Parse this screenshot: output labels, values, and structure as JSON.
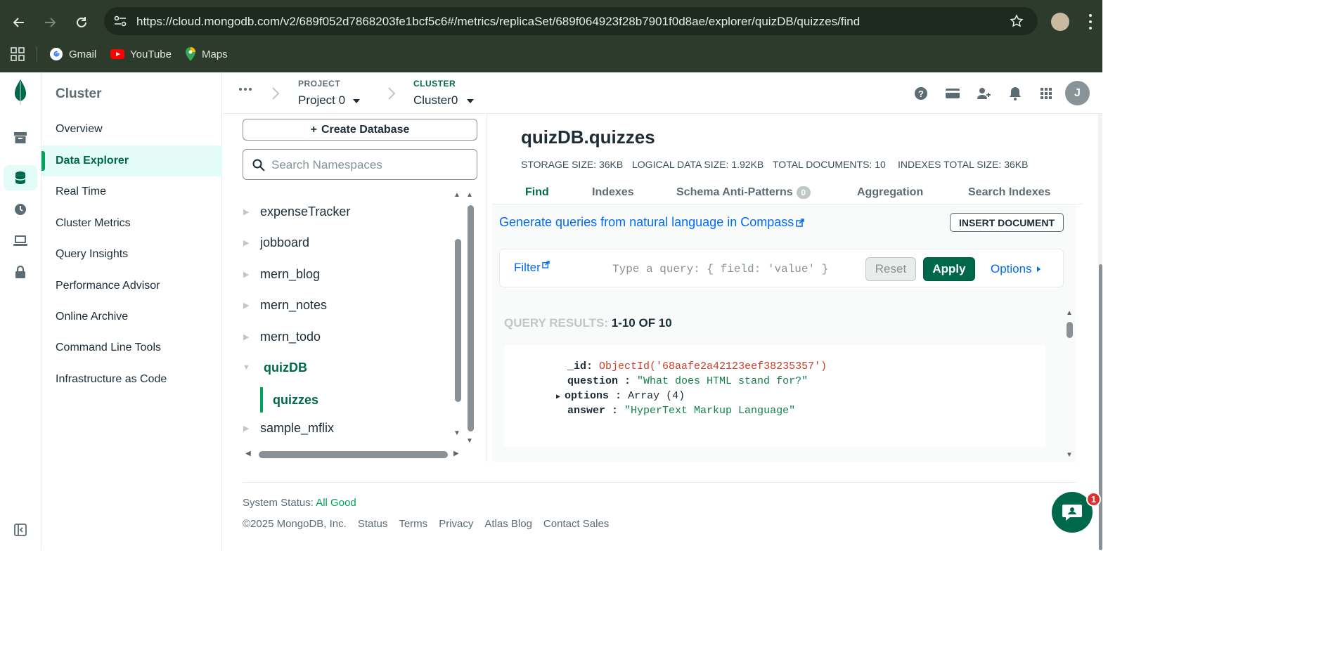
{
  "browser": {
    "url": "https://cloud.mongodb.com/v2/689f052d7868203fe1bcf5c6#/metrics/replicaSet/689f064923f28b7901f0d8ae/explorer/quizDB/quizzes/find",
    "bookmarks": [
      {
        "label": "Gmail",
        "icon": "gmail-icon"
      },
      {
        "label": "YouTube",
        "icon": "youtube-icon"
      },
      {
        "label": "Maps",
        "icon": "maps-icon"
      }
    ]
  },
  "sidenav": {
    "title": "Cluster",
    "items": [
      {
        "label": "Overview"
      },
      {
        "label": "Data Explorer",
        "active": true
      },
      {
        "label": "Real Time"
      },
      {
        "label": "Cluster Metrics"
      },
      {
        "label": "Query Insights"
      },
      {
        "label": "Performance Advisor"
      },
      {
        "label": "Online Archive"
      },
      {
        "label": "Command Line Tools"
      },
      {
        "label": "Infrastructure as Code"
      }
    ]
  },
  "header": {
    "project_label": "PROJECT",
    "project_value": "Project 0",
    "cluster_label": "CLUSTER",
    "cluster_value": "Cluster0",
    "avatar_initial": "J"
  },
  "namespaces": {
    "create_label": "Create Database",
    "search_placeholder": "Search Namespaces",
    "databases": [
      "expenseTracker",
      "jobboard",
      "mern_blog",
      "mern_notes",
      "mern_todo",
      "quizDB",
      "sample_mflix"
    ],
    "open_db": "quizDB",
    "collection": "quizzes"
  },
  "collection": {
    "title": "quizDB.quizzes",
    "stats": {
      "storage": "STORAGE SIZE: 36KB",
      "logical": "LOGICAL DATA SIZE: 1.92KB",
      "total_docs": "TOTAL DOCUMENTS: 10",
      "indexes": "INDEXES TOTAL SIZE: 36KB"
    },
    "tabs": {
      "find": "Find",
      "indexes": "Indexes",
      "schema": "Schema Anti-Patterns",
      "schema_count": "0",
      "aggregation": "Aggregation",
      "search_indexes": "Search Indexes"
    },
    "compass_link": "Generate queries from natural language in Compass",
    "insert_label": "INSERT DOCUMENT",
    "filter": {
      "label": "Filter",
      "placeholder": "Type a query: { field: 'value' }",
      "reset": "Reset",
      "apply": "Apply",
      "options": "Options"
    },
    "results_label": "QUERY RESULTS:",
    "results_count": "1-10 OF 10",
    "document": {
      "id_key": "_id",
      "id_value": "ObjectId('68aafe2a42123eef38235357')",
      "question_key": "question",
      "question_value": "\"What does HTML stand for?\"",
      "options_key": "options",
      "options_value": "Array (4)",
      "answer_key": "answer",
      "answer_value": "\"HyperText Markup Language\""
    }
  },
  "footer": {
    "status_label": "System Status:",
    "status_value": "All Good",
    "links": [
      "©2025 MongoDB, Inc.",
      "Status",
      "Terms",
      "Privacy",
      "Atlas Blog",
      "Contact Sales"
    ]
  },
  "chat": {
    "badge": "1"
  },
  "colors": {
    "brand_green": "#00684a",
    "accent_green": "#00a35c",
    "link_blue": "#016bf8",
    "chrome_bg": "#2c3b2c"
  }
}
